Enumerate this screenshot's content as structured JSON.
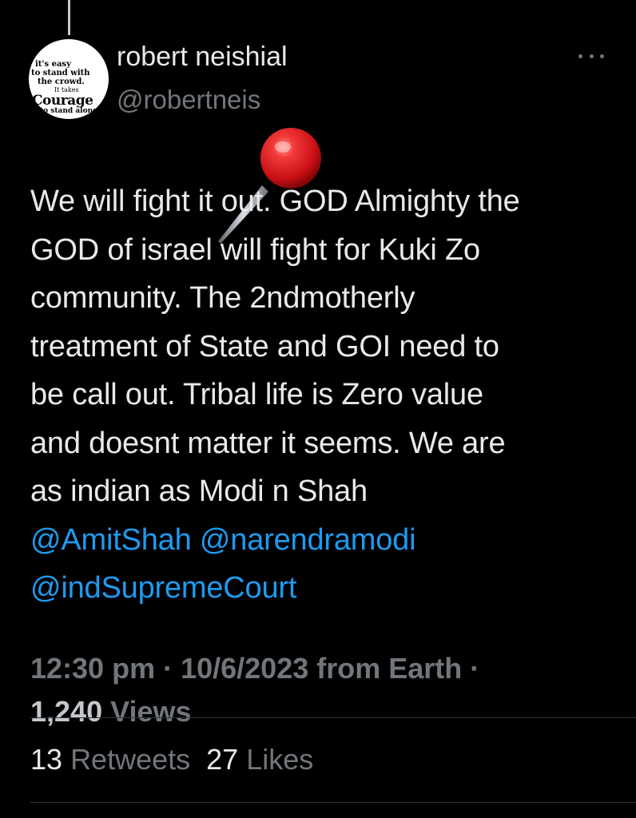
{
  "author": {
    "display_name": "robert neishial",
    "handle": "@robertneis",
    "avatar_text": [
      "it's easy",
      "to stand with",
      "the crowd.",
      "It takes",
      "Courage",
      "to stand alone"
    ]
  },
  "menu": {
    "icon": "more-horizontal-icon"
  },
  "tweet": {
    "emoji": "round-pushpin-icon",
    "text_lines": [
      "We will fight it out. GOD Almighty the",
      "GOD of israel will fight for Kuki Zo",
      "community. The 2ndmotherly",
      "treatment of State and GOI need to",
      "be call out. Tribal life is Zero value",
      "and doesnt matter it seems. We are",
      "as indian as Modi n Shah"
    ],
    "mentions": [
      "@AmitShah",
      "@narendramodi",
      "@indSupremeCourt"
    ]
  },
  "meta": {
    "time": "12:30 pm",
    "sep1": " · ",
    "date": "10/6/2023",
    "source": " from Earth",
    "sep2": " ·",
    "views_count": "1,240",
    "views_label": " Views"
  },
  "stats": {
    "retweets_count": "13",
    "retweets_label": "Retweets",
    "likes_count": "27",
    "likes_label": "Likes"
  },
  "colors": {
    "background": "#000000",
    "text": "#e7e9ea",
    "secondary": "#71767b",
    "link": "#1d9bf0"
  }
}
